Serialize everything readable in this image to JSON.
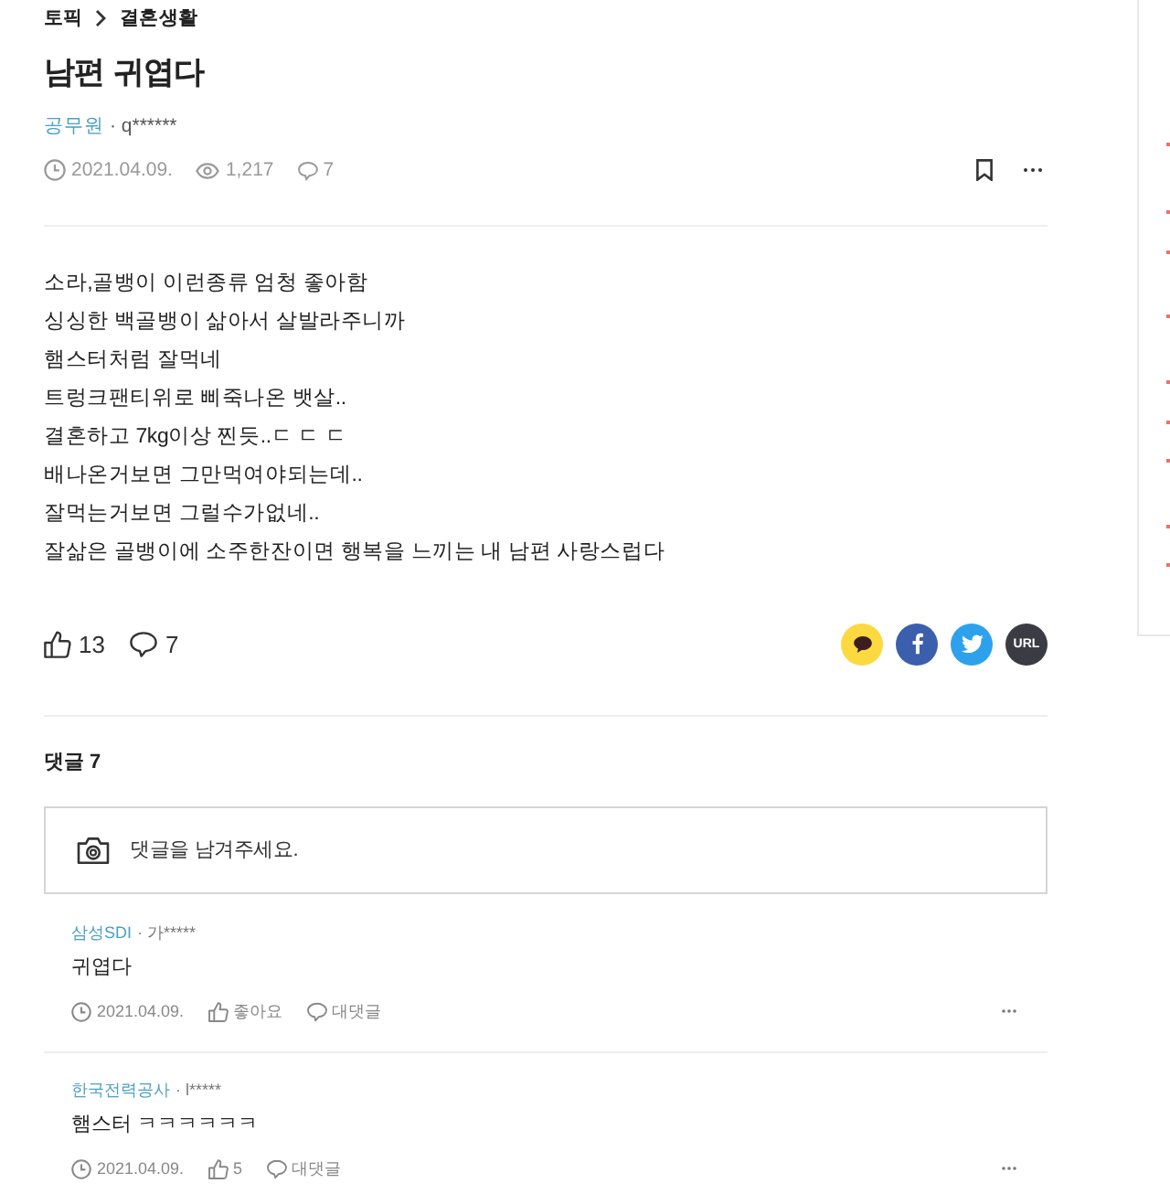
{
  "breadcrumb": [
    {
      "label": "토픽"
    },
    {
      "label": "결혼생활"
    }
  ],
  "post": {
    "title": "남편 귀엽다",
    "company": "공무원",
    "separator": "·",
    "author": "q******",
    "date": "2021.04.09.",
    "views": "1,217",
    "comment_count": "7",
    "body": [
      "소라,골뱅이 이런종류 엄청 좋아함",
      "싱싱한 백골뱅이 삶아서 살발라주니까",
      "햄스터처럼 잘먹네",
      "트렁크팬티위로 삐죽나온 뱃살..",
      "결혼하고 7kg이상 찐듯..ㄷ ㄷ ㄷ",
      "배나온거보면 그만먹여야되는데..",
      "잘먹는거보면 그럴수가없네..",
      "잘삶은 골뱅이에 소주한잔이면 행복을 느끼는 내 남편 사랑스럽다"
    ],
    "likes": "13",
    "comments": "7"
  },
  "share": [
    {
      "kind": "chat"
    },
    {
      "kind": "facebook"
    },
    {
      "kind": "twitter"
    },
    {
      "kind": "link",
      "label": "URL"
    }
  ],
  "comment_section": {
    "heading": "댓글 7",
    "placeholder": "댓글을 남겨주세요."
  },
  "comments": [
    {
      "company": "삼성SDI",
      "separator": "·",
      "author": "가*****",
      "text": "귀엽다",
      "date": "2021.04.09.",
      "like_label": "좋아요",
      "reply_label": "대댓글"
    },
    {
      "company": "한국전력공사",
      "separator": "·",
      "author": "l*****",
      "text": "햄스터 ㅋㅋㅋㅋㅋㅋ",
      "date": "2021.04.09.",
      "like_label": "5",
      "reply_label": "대댓글"
    }
  ]
}
